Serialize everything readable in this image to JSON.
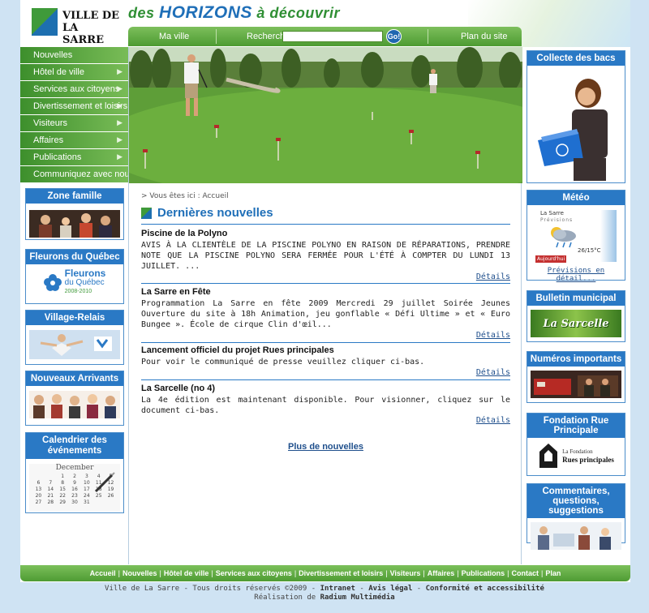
{
  "header": {
    "logo_line1": "VILLE DE",
    "logo_line2": "LA SARRE",
    "slogan_a": "des",
    "slogan_b": "HORIZONS",
    "slogan_c": "à découvrir"
  },
  "topnav": {
    "ma_ville": "Ma ville",
    "recherche": "Recherche",
    "search_value": "",
    "go": "Go!",
    "plan_du_site": "Plan du site"
  },
  "leftnav": {
    "items": [
      {
        "label": "Nouvelles",
        "arrow": ""
      },
      {
        "label": "Hôtel de ville",
        "arrow": "▶"
      },
      {
        "label": "Services aux citoyens",
        "arrow": "▶"
      },
      {
        "label": "Divertissement et loisirs",
        "arrow": "▶"
      },
      {
        "label": "Visiteurs",
        "arrow": "▶"
      },
      {
        "label": "Affaires",
        "arrow": "▶"
      },
      {
        "label": "Publications",
        "arrow": "▶"
      },
      {
        "label": "Communiquez avec nous",
        "arrow": ""
      }
    ]
  },
  "left_boxes": {
    "zone_famille": "Zone famille",
    "fleurons": "Fleurons du Québec",
    "fleurons_logo_title": "Fleurons",
    "fleurons_logo_sub": "du Québec",
    "fleurons_logo_years": "2008-2010",
    "village_relais": "Village-Relais",
    "nouveaux_arrivants": "Nouveaux Arrivants",
    "calendrier": "Calendrier des événements",
    "calendar_month": "December",
    "calendar_numbers": [
      "1",
      "2",
      "3",
      "4",
      "5",
      "6",
      "7",
      "8",
      "9",
      "10",
      "11",
      "12",
      "13",
      "14",
      "15",
      "16",
      "17",
      "18",
      "19",
      "20",
      "21",
      "22",
      "23",
      "24",
      "25",
      "26",
      "27",
      "28",
      "29",
      "30",
      "31"
    ]
  },
  "content": {
    "breadcrumb": "> Vous êtes ici : Accueil",
    "section_title": "Dernières nouvelles",
    "news": [
      {
        "title": "Piscine de la Polyno",
        "text": "AVIS À LA CLIENTÈLE DE LA PISCINE POLYNO    EN RAISON DE RÉPARATIONS, PRENDRE NOTE QUE LA PISCINE POLYNO SERA FERMÉE POUR L'ÉTÉ À COMPTER DU LUNDI 13 JUILLET.  ...",
        "details": "Détails"
      },
      {
        "title": "La Sarre en Fête",
        "text": "Programmation La Sarre en fête 2009  Mercredi 29 juillet  Soirée Jeunes  Ouverture du site à 18h Animation, jeu gonflable « Défi Ultime » et « Euro Bungee ». École de cirque Clin d'œil...",
        "details": "Détails"
      },
      {
        "title": "Lancement officiel du projet Rues principales",
        "text": "Pour voir le communiqué de presse veuillez cliquer ci-bas.",
        "details": "Détails"
      },
      {
        "title": "La Sarcelle (no 4)",
        "text": "La 4e édition est maintenant disponible.  Pour visionner, cliquez sur le document ci-bas.",
        "details": "Détails"
      }
    ],
    "more_news": "Plus de nouvelles"
  },
  "right_boxes": {
    "collecte": "Collecte des bacs",
    "meteo": "Météo",
    "meteo_city": "La Sarre",
    "meteo_sub": "Prévisions",
    "meteo_day": "Aujourd'hui",
    "meteo_temp": "26/15°C",
    "meteo_link": "Prévisions en détail...",
    "bulletin": "Bulletin municipal",
    "bulletin_logo": "La Sarcelle",
    "numeros": "Numéros importants",
    "fondation": "Fondation Rue Principale",
    "fondation_logo_a": "La Fondation",
    "fondation_logo_b": "Rues principales",
    "commentaires": "Commentaires, questions, suggestions"
  },
  "footer": {
    "links": [
      "Accueil",
      "Nouvelles",
      "Hôtel de ville",
      "Services aux citoyens",
      "Divertissement et loisirs",
      "Visiteurs",
      "Affaires",
      "Publications",
      "Contact",
      "Plan"
    ],
    "copyright_prefix": "Ville de La Sarre - Tous droits réservés ©2009 - ",
    "intranet": "Intranet",
    "avis_legal": "Avis légal",
    "conformite": "Conformité et accessibilité",
    "realisation_prefix": "Réalisation de ",
    "realisation": "Radium Multimédia"
  },
  "colors": {
    "green": "#4e9b33",
    "blue": "#2a79c5",
    "background": "#cfe3f3"
  }
}
